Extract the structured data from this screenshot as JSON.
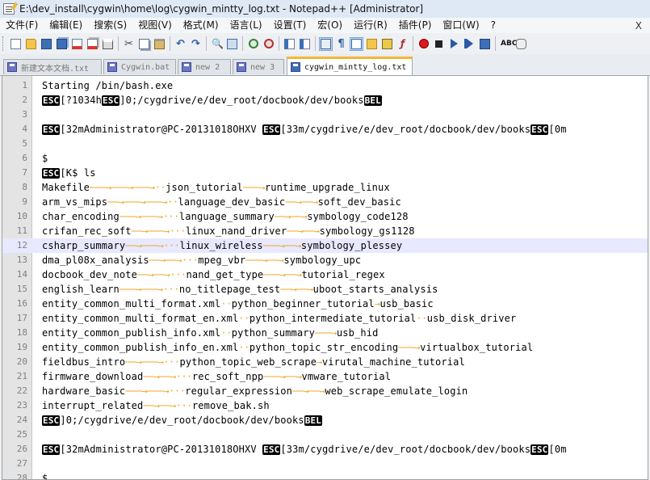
{
  "window": {
    "title": "E:\\dev_install\\cygwin\\home\\log\\cygwin_mintty_log.txt - Notepad++ [Administrator]"
  },
  "menu": {
    "items": [
      "文件(F)",
      "编辑(E)",
      "搜索(S)",
      "视图(V)",
      "格式(M)",
      "语言(L)",
      "设置(T)",
      "宏(O)",
      "运行(R)",
      "插件(P)",
      "窗口(W)",
      "?"
    ],
    "close_label": "X"
  },
  "toolbar": {
    "icons": [
      "new-file-icon",
      "open-file-icon",
      "save-icon",
      "save-all-icon",
      "close-icon",
      "close-all-icon",
      "print-icon",
      "cut-icon",
      "copy-icon",
      "paste-icon",
      "undo-icon",
      "redo-icon",
      "find-icon",
      "replace-icon",
      "zoom-in-icon",
      "zoom-out-icon",
      "sync-scroll-icon",
      "word-wrap-icon",
      "show-all-chars-icon",
      "indent-guide-icon",
      "folder-icon",
      "image-icon",
      "function-list-icon",
      "record-macro-icon",
      "stop-macro-icon",
      "play-macro-icon",
      "play-multiple-macro-icon",
      "save-macro-icon",
      "spell-check-icon",
      "plugin-icon"
    ],
    "glyphs": {
      "cut": "✂",
      "undo": "↶",
      "redo": "↷",
      "find": "🔍",
      "allchars": "¶",
      "func": "ƒ",
      "spell": "ABC"
    }
  },
  "tabs": [
    {
      "label": "新建文本文档.txt",
      "active": false
    },
    {
      "label": "Cygwin.bat",
      "active": false
    },
    {
      "label": "new  2",
      "active": false
    },
    {
      "label": "new  3",
      "active": false
    },
    {
      "label": "cygwin_mintty_log.txt",
      "active": true
    }
  ],
  "editor": {
    "current_line": 12,
    "lines": [
      {
        "n": "1",
        "segs": [
          {
            "t": "Starting /bin/bash.exe"
          }
        ]
      },
      {
        "n": "2",
        "segs": [
          {
            "c": "ESC"
          },
          {
            "t": "[?1034h"
          },
          {
            "c": "ESC"
          },
          {
            "t": "]0;/cygdrive/e/dev_root/docbook/dev/books"
          },
          {
            "c": "BEL"
          }
        ]
      },
      {
        "n": "3",
        "segs": []
      },
      {
        "n": "4",
        "segs": [
          {
            "c": "ESC"
          },
          {
            "t": "[32mAdministrator@PC-20131018OHXV "
          },
          {
            "c": "ESC"
          },
          {
            "t": "[33m/cygdrive/e/dev_root/docbook/dev/books"
          },
          {
            "c": "ESC"
          },
          {
            "t": "[0m"
          }
        ]
      },
      {
        "n": "5",
        "segs": []
      },
      {
        "n": "6",
        "segs": [
          {
            "t": "$"
          }
        ]
      },
      {
        "n": "7",
        "segs": [
          {
            "c": "ESC"
          },
          {
            "t": "[K$ ls"
          }
        ]
      },
      {
        "n": "8",
        "segs": [
          {
            "t": "Makefile"
          },
          {
            "a": "───→───→───→··"
          },
          {
            "t": "json_tutorial"
          },
          {
            "a": "───→"
          },
          {
            "t": "runtime_upgrade_linux"
          }
        ]
      },
      {
        "n": "9",
        "segs": [
          {
            "t": "arm_vs_mips"
          },
          {
            "a": "──→───→───→··"
          },
          {
            "t": "language_dev_basic"
          },
          {
            "a": "──→──→"
          },
          {
            "t": "soft_dev_basic"
          }
        ]
      },
      {
        "n": "10",
        "segs": [
          {
            "t": "char_encoding"
          },
          {
            "a": "───→───→···"
          },
          {
            "t": "language_summary"
          },
          {
            "a": "──→──→"
          },
          {
            "t": "symbology_code128"
          }
        ]
      },
      {
        "n": "11",
        "segs": [
          {
            "t": "crifan_rec_soft"
          },
          {
            "a": "──→───→···"
          },
          {
            "t": "linux_nand_driver"
          },
          {
            "a": "──→──→"
          },
          {
            "t": "symbology_gs1128"
          }
        ]
      },
      {
        "n": "12",
        "segs": [
          {
            "t": "csharp_summary"
          },
          {
            "a": "──→───→···"
          },
          {
            "t": "linux_wireless"
          },
          {
            "a": "───→──→"
          },
          {
            "t": "symbology_plessey"
          }
        ]
      },
      {
        "n": "13",
        "segs": [
          {
            "t": "dma_pl08x_analysis"
          },
          {
            "a": "──→──→···"
          },
          {
            "t": "mpeg_vbr"
          },
          {
            "a": "───→──→"
          },
          {
            "t": "symbology_upc"
          }
        ]
      },
      {
        "n": "14",
        "segs": [
          {
            "t": "docbook_dev_note"
          },
          {
            "a": "──→──→···"
          },
          {
            "t": "nand_get_type"
          },
          {
            "a": "───→──→"
          },
          {
            "t": "tutorial_regex"
          }
        ]
      },
      {
        "n": "15",
        "segs": [
          {
            "t": "english_learn"
          },
          {
            "a": "───→───→···"
          },
          {
            "t": "no_titlepage_test"
          },
          {
            "a": "──→──→"
          },
          {
            "t": "uboot_starts_analysis"
          }
        ]
      },
      {
        "n": "16",
        "segs": [
          {
            "t": "entity_common_multi_format.xml"
          },
          {
            "a": "··"
          },
          {
            "t": "python_beginner_tutorial"
          },
          {
            "a": "→"
          },
          {
            "t": "usb_basic"
          }
        ]
      },
      {
        "n": "17",
        "segs": [
          {
            "t": "entity_common_multi_format_en.xml"
          },
          {
            "a": "··"
          },
          {
            "t": "python_intermediate_tutorial"
          },
          {
            "a": "··"
          },
          {
            "t": "usb_disk_driver"
          }
        ]
      },
      {
        "n": "18",
        "segs": [
          {
            "t": "entity_common_publish_info.xml"
          },
          {
            "a": "··"
          },
          {
            "t": "python_summary"
          },
          {
            "a": "───→"
          },
          {
            "t": "usb_hid"
          }
        ]
      },
      {
        "n": "19",
        "segs": [
          {
            "t": "entity_common_publish_info_en.xml"
          },
          {
            "a": "··"
          },
          {
            "t": "python_topic_str_encoding"
          },
          {
            "a": "───→"
          },
          {
            "t": "virtualbox_tutorial"
          }
        ]
      },
      {
        "n": "20",
        "segs": [
          {
            "t": "fieldbus_intro"
          },
          {
            "a": "──→───→···"
          },
          {
            "t": "python_topic_web_scrape"
          },
          {
            "a": "→"
          },
          {
            "t": "virutal_machine_tutorial"
          }
        ]
      },
      {
        "n": "21",
        "segs": [
          {
            "t": "firmware_download"
          },
          {
            "a": "──→──→···"
          },
          {
            "t": "rec_soft_npp"
          },
          {
            "a": "───→──→"
          },
          {
            "t": "vmware_tutorial"
          }
        ]
      },
      {
        "n": "22",
        "segs": [
          {
            "t": "hardware_basic"
          },
          {
            "a": "───→───→···"
          },
          {
            "t": "regular_expression"
          },
          {
            "a": "──→──→"
          },
          {
            "t": "web_scrape_emulate_login"
          }
        ]
      },
      {
        "n": "23",
        "segs": [
          {
            "t": "interrupt_related"
          },
          {
            "a": "──→──→···"
          },
          {
            "t": "remove_bak.sh"
          }
        ]
      },
      {
        "n": "24",
        "segs": [
          {
            "c": "ESC"
          },
          {
            "t": "]0;/cygdrive/e/dev_root/docbook/dev/books"
          },
          {
            "c": "BEL"
          }
        ]
      },
      {
        "n": "25",
        "segs": []
      },
      {
        "n": "26",
        "segs": [
          {
            "c": "ESC"
          },
          {
            "t": "[32mAdministrator@PC-20131018OHXV "
          },
          {
            "c": "ESC"
          },
          {
            "t": "[33m/cygdrive/e/dev_root/docbook/dev/books"
          },
          {
            "c": "ESC"
          },
          {
            "t": "[0m"
          }
        ]
      },
      {
        "n": "27",
        "segs": []
      },
      {
        "n": "28",
        "segs": [
          {
            "t": "$"
          }
        ]
      }
    ]
  }
}
